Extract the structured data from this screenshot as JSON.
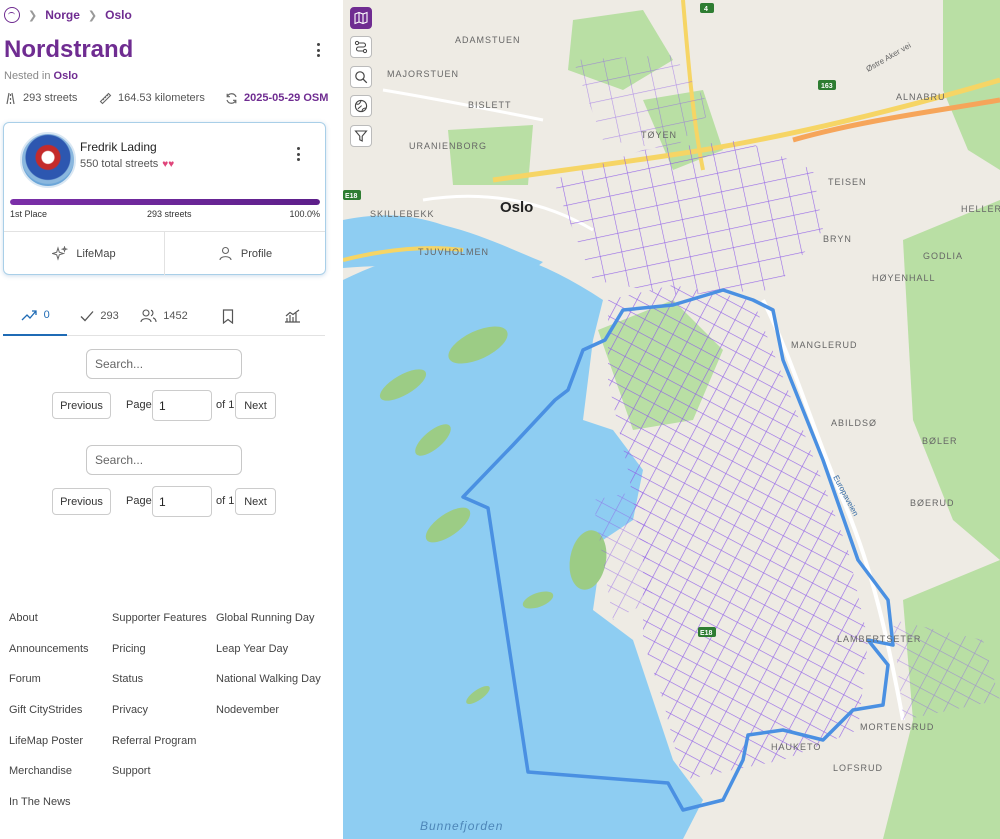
{
  "breadcrumb": {
    "items": [
      "Norge",
      "Oslo"
    ]
  },
  "page": {
    "title": "Nordstrand",
    "nested_prefix": "Nested in",
    "nested_parent": "Oslo"
  },
  "stats": {
    "streets": "293 streets",
    "distance": "164.53 kilometers",
    "osm": "2025-05-29 OSM"
  },
  "leader": {
    "name": "Fredrik Lading",
    "total": "550 total streets",
    "progress_fraction": 1.0,
    "place": "1st Place",
    "streets": "293 streets",
    "percent": "100.0%"
  },
  "card_actions": {
    "lifemap": "LifeMap",
    "profile": "Profile"
  },
  "tabs": [
    {
      "icon": "trending-up-icon",
      "label": "0"
    },
    {
      "icon": "check-icon",
      "label": "293"
    },
    {
      "icon": "users-icon",
      "label": "1452"
    },
    {
      "icon": "bookmark-icon",
      "label": ""
    },
    {
      "icon": "chart-icon",
      "label": ""
    }
  ],
  "list1": {
    "search_placeholder": "Search...",
    "prev": "Previous",
    "page_label": "Page",
    "page_value": "1",
    "of": "of 1",
    "next": "Next"
  },
  "list2": {
    "search_placeholder": "Search...",
    "prev": "Previous",
    "page_label": "Page",
    "page_value": "1",
    "of": "of 1",
    "next": "Next"
  },
  "footer": {
    "col1": [
      "About",
      "Announcements",
      "Forum",
      "Gift CityStrides",
      "LifeMap Poster",
      "Merchandise",
      "In The News"
    ],
    "col2": [
      "Supporter Features",
      "Pricing",
      "Status",
      "Privacy",
      "Referral Program",
      "Support"
    ],
    "col3": [
      "Global Running Day",
      "Leap Year Day",
      "National Walking Day",
      "Nodevember"
    ]
  },
  "map": {
    "tools": [
      "map-icon",
      "route-icon",
      "search-icon",
      "globe-icon",
      "filter-icon"
    ],
    "labels": {
      "adamstuen": "ADAMSTUEN",
      "majorstuen": "MAJORSTUEN",
      "bislett": "BISLETT",
      "uranienborg": "URANIENBORG",
      "toyen": "TØYEN",
      "oslo": "Oslo",
      "skillebekk": "SKILLEBEKK",
      "tjuvholmen": "TJUVHOLMEN",
      "teisen": "TEISEN",
      "helleru": "HELLERU",
      "alnabru": "ALNABRU",
      "bryn": "BRYN",
      "hoyenhall": "HØYENHALL",
      "godlia": "GODLIA",
      "manglerud": "MANGLERUD",
      "abildso": "ABILDSØ",
      "boler": "BØLER",
      "boerud": "BØERUD",
      "lambertseter": "LAMBERTSETER",
      "mortensrud": "MORTENSRUD",
      "lofsrud": "LOFSRUD",
      "hauketo": "HAUKETO",
      "bunnefjorden": "Bunnefjorden",
      "ostre_aker_vei": "Østre Aker vei",
      "europaveien": "Europaveien",
      "e18_a": "E18",
      "e18_b": "E18",
      "r163": "163",
      "r4": "4"
    },
    "colors": {
      "streets": "#7b4be8",
      "boundary": "#4a90e2",
      "water": "#8ecdf2",
      "park": "#b9dfa4",
      "road": "#f6d565"
    }
  }
}
